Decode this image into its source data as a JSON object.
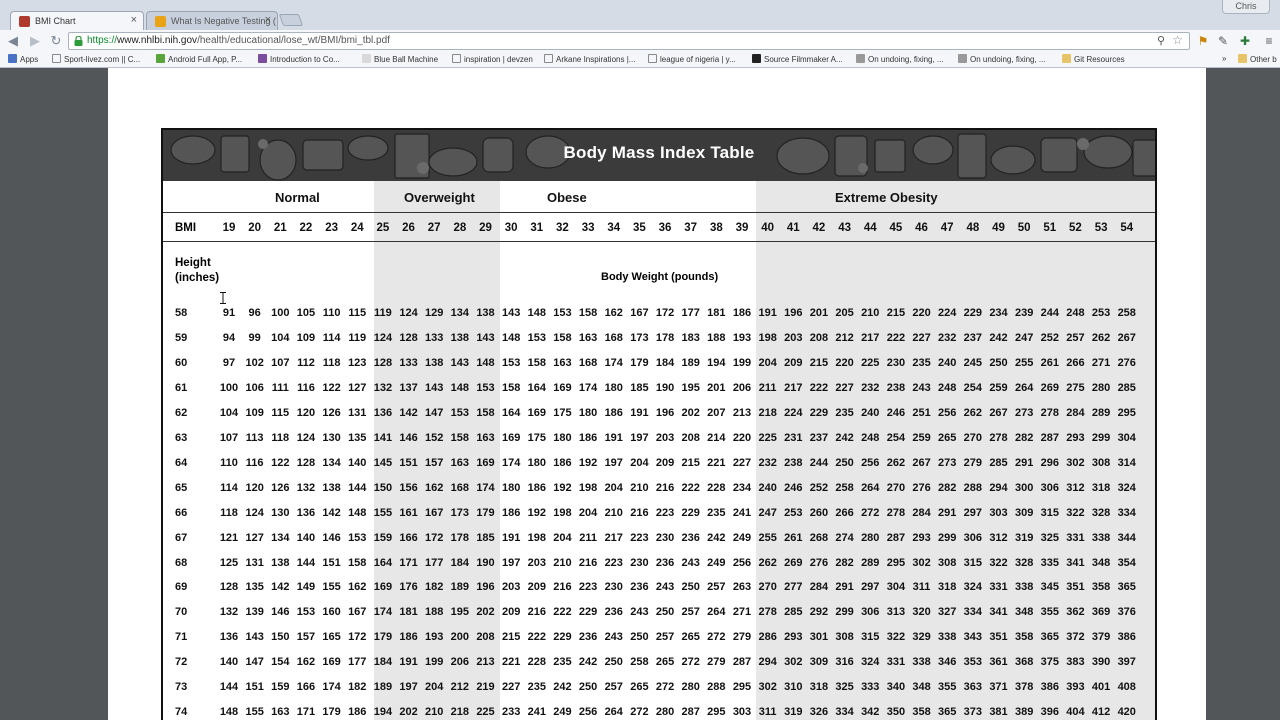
{
  "browser": {
    "tabs": [
      {
        "title": "BMI Chart",
        "active": true,
        "favicon_color": "#c0392b"
      },
      {
        "title": "What Is Negative Testing (",
        "active": false,
        "favicon_color": "#e8a317"
      }
    ],
    "user_badge": "Chris",
    "url_scheme": "https://",
    "url_host": "www.nhlbi.nih.gov",
    "url_path": "/health/educational/lose_wt/BMI/bmi_tbl.pdf",
    "bookmarks": [
      "Apps",
      "Sport-livez.com || C...",
      "Android Full App, P...",
      "Introduction to Co...",
      "Blue Ball Machine",
      "inspiration | devzen",
      "Arkane Inspirations |...",
      "league of nigeria | y...",
      "Source Filmmaker A...",
      "On undoing, fixing, ...",
      "On undoing, fixing, ...",
      "Git Resources"
    ],
    "bookmarks_overflow": "»",
    "other_bookmarks": "Other b"
  },
  "table": {
    "title": "Body Mass Index Table",
    "categories": [
      "Normal",
      "Overweight",
      "Obese",
      "Extreme Obesity"
    ],
    "bmi_label": "BMI",
    "height_label": "Height (inches)",
    "weight_label": "Body Weight (pounds)",
    "bmi_values": [
      19,
      20,
      21,
      22,
      23,
      24,
      25,
      26,
      27,
      28,
      29,
      30,
      31,
      32,
      33,
      34,
      35,
      36,
      37,
      38,
      39,
      40,
      41,
      42,
      43,
      44,
      45,
      46,
      47,
      48,
      49,
      50,
      51,
      52,
      53,
      54
    ],
    "rows": [
      {
        "height": 58,
        "weights": [
          91,
          96,
          100,
          105,
          110,
          115,
          119,
          124,
          129,
          134,
          138,
          143,
          148,
          153,
          158,
          162,
          167,
          172,
          177,
          181,
          186,
          191,
          196,
          201,
          205,
          210,
          215,
          220,
          224,
          229,
          234,
          239,
          244,
          248,
          253,
          258
        ]
      },
      {
        "height": 59,
        "weights": [
          94,
          99,
          104,
          109,
          114,
          119,
          124,
          128,
          133,
          138,
          143,
          148,
          153,
          158,
          163,
          168,
          173,
          178,
          183,
          188,
          193,
          198,
          203,
          208,
          212,
          217,
          222,
          227,
          232,
          237,
          242,
          247,
          252,
          257,
          262,
          267
        ]
      },
      {
        "height": 60,
        "weights": [
          97,
          102,
          107,
          112,
          118,
          123,
          128,
          133,
          138,
          143,
          148,
          153,
          158,
          163,
          168,
          174,
          179,
          184,
          189,
          194,
          199,
          204,
          209,
          215,
          220,
          225,
          230,
          235,
          240,
          245,
          250,
          255,
          261,
          266,
          271,
          276
        ]
      },
      {
        "height": 61,
        "weights": [
          100,
          106,
          111,
          116,
          122,
          127,
          132,
          137,
          143,
          148,
          153,
          158,
          164,
          169,
          174,
          180,
          185,
          190,
          195,
          201,
          206,
          211,
          217,
          222,
          227,
          232,
          238,
          243,
          248,
          254,
          259,
          264,
          269,
          275,
          280,
          285
        ]
      },
      {
        "height": 62,
        "weights": [
          104,
          109,
          115,
          120,
          126,
          131,
          136,
          142,
          147,
          153,
          158,
          164,
          169,
          175,
          180,
          186,
          191,
          196,
          202,
          207,
          213,
          218,
          224,
          229,
          235,
          240,
          246,
          251,
          256,
          262,
          267,
          273,
          278,
          284,
          289,
          295
        ]
      },
      {
        "height": 63,
        "weights": [
          107,
          113,
          118,
          124,
          130,
          135,
          141,
          146,
          152,
          158,
          163,
          169,
          175,
          180,
          186,
          191,
          197,
          203,
          208,
          214,
          220,
          225,
          231,
          237,
          242,
          248,
          254,
          259,
          265,
          270,
          278,
          282,
          287,
          293,
          299,
          304
        ]
      },
      {
        "height": 64,
        "weights": [
          110,
          116,
          122,
          128,
          134,
          140,
          145,
          151,
          157,
          163,
          169,
          174,
          180,
          186,
          192,
          197,
          204,
          209,
          215,
          221,
          227,
          232,
          238,
          244,
          250,
          256,
          262,
          267,
          273,
          279,
          285,
          291,
          296,
          302,
          308,
          314
        ]
      },
      {
        "height": 65,
        "weights": [
          114,
          120,
          126,
          132,
          138,
          144,
          150,
          156,
          162,
          168,
          174,
          180,
          186,
          192,
          198,
          204,
          210,
          216,
          222,
          228,
          234,
          240,
          246,
          252,
          258,
          264,
          270,
          276,
          282,
          288,
          294,
          300,
          306,
          312,
          318,
          324
        ]
      },
      {
        "height": 66,
        "weights": [
          118,
          124,
          130,
          136,
          142,
          148,
          155,
          161,
          167,
          173,
          179,
          186,
          192,
          198,
          204,
          210,
          216,
          223,
          229,
          235,
          241,
          247,
          253,
          260,
          266,
          272,
          278,
          284,
          291,
          297,
          303,
          309,
          315,
          322,
          328,
          334
        ]
      },
      {
        "height": 67,
        "weights": [
          121,
          127,
          134,
          140,
          146,
          153,
          159,
          166,
          172,
          178,
          185,
          191,
          198,
          204,
          211,
          217,
          223,
          230,
          236,
          242,
          249,
          255,
          261,
          268,
          274,
          280,
          287,
          293,
          299,
          306,
          312,
          319,
          325,
          331,
          338,
          344
        ]
      },
      {
        "height": 68,
        "weights": [
          125,
          131,
          138,
          144,
          151,
          158,
          164,
          171,
          177,
          184,
          190,
          197,
          203,
          210,
          216,
          223,
          230,
          236,
          243,
          249,
          256,
          262,
          269,
          276,
          282,
          289,
          295,
          302,
          308,
          315,
          322,
          328,
          335,
          341,
          348,
          354
        ]
      },
      {
        "height": 69,
        "weights": [
          128,
          135,
          142,
          149,
          155,
          162,
          169,
          176,
          182,
          189,
          196,
          203,
          209,
          216,
          223,
          230,
          236,
          243,
          250,
          257,
          263,
          270,
          277,
          284,
          291,
          297,
          304,
          311,
          318,
          324,
          331,
          338,
          345,
          351,
          358,
          365
        ]
      },
      {
        "height": 70,
        "weights": [
          132,
          139,
          146,
          153,
          160,
          167,
          174,
          181,
          188,
          195,
          202,
          209,
          216,
          222,
          229,
          236,
          243,
          250,
          257,
          264,
          271,
          278,
          285,
          292,
          299,
          306,
          313,
          320,
          327,
          334,
          341,
          348,
          355,
          362,
          369,
          376
        ]
      },
      {
        "height": 71,
        "weights": [
          136,
          143,
          150,
          157,
          165,
          172,
          179,
          186,
          193,
          200,
          208,
          215,
          222,
          229,
          236,
          243,
          250,
          257,
          265,
          272,
          279,
          286,
          293,
          301,
          308,
          315,
          322,
          329,
          338,
          343,
          351,
          358,
          365,
          372,
          379,
          386
        ]
      },
      {
        "height": 72,
        "weights": [
          140,
          147,
          154,
          162,
          169,
          177,
          184,
          191,
          199,
          206,
          213,
          221,
          228,
          235,
          242,
          250,
          258,
          265,
          272,
          279,
          287,
          294,
          302,
          309,
          316,
          324,
          331,
          338,
          346,
          353,
          361,
          368,
          375,
          383,
          390,
          397
        ]
      },
      {
        "height": 73,
        "weights": [
          144,
          151,
          159,
          166,
          174,
          182,
          189,
          197,
          204,
          212,
          219,
          227,
          235,
          242,
          250,
          257,
          265,
          272,
          280,
          288,
          295,
          302,
          310,
          318,
          325,
          333,
          340,
          348,
          355,
          363,
          371,
          378,
          386,
          393,
          401,
          408
        ]
      },
      {
        "height": 74,
        "weights": [
          148,
          155,
          163,
          171,
          179,
          186,
          194,
          202,
          210,
          218,
          225,
          233,
          241,
          249,
          256,
          264,
          272,
          280,
          287,
          295,
          303,
          311,
          319,
          326,
          334,
          342,
          350,
          358,
          365,
          373,
          381,
          389,
          396,
          404,
          412,
          420
        ]
      }
    ]
  }
}
